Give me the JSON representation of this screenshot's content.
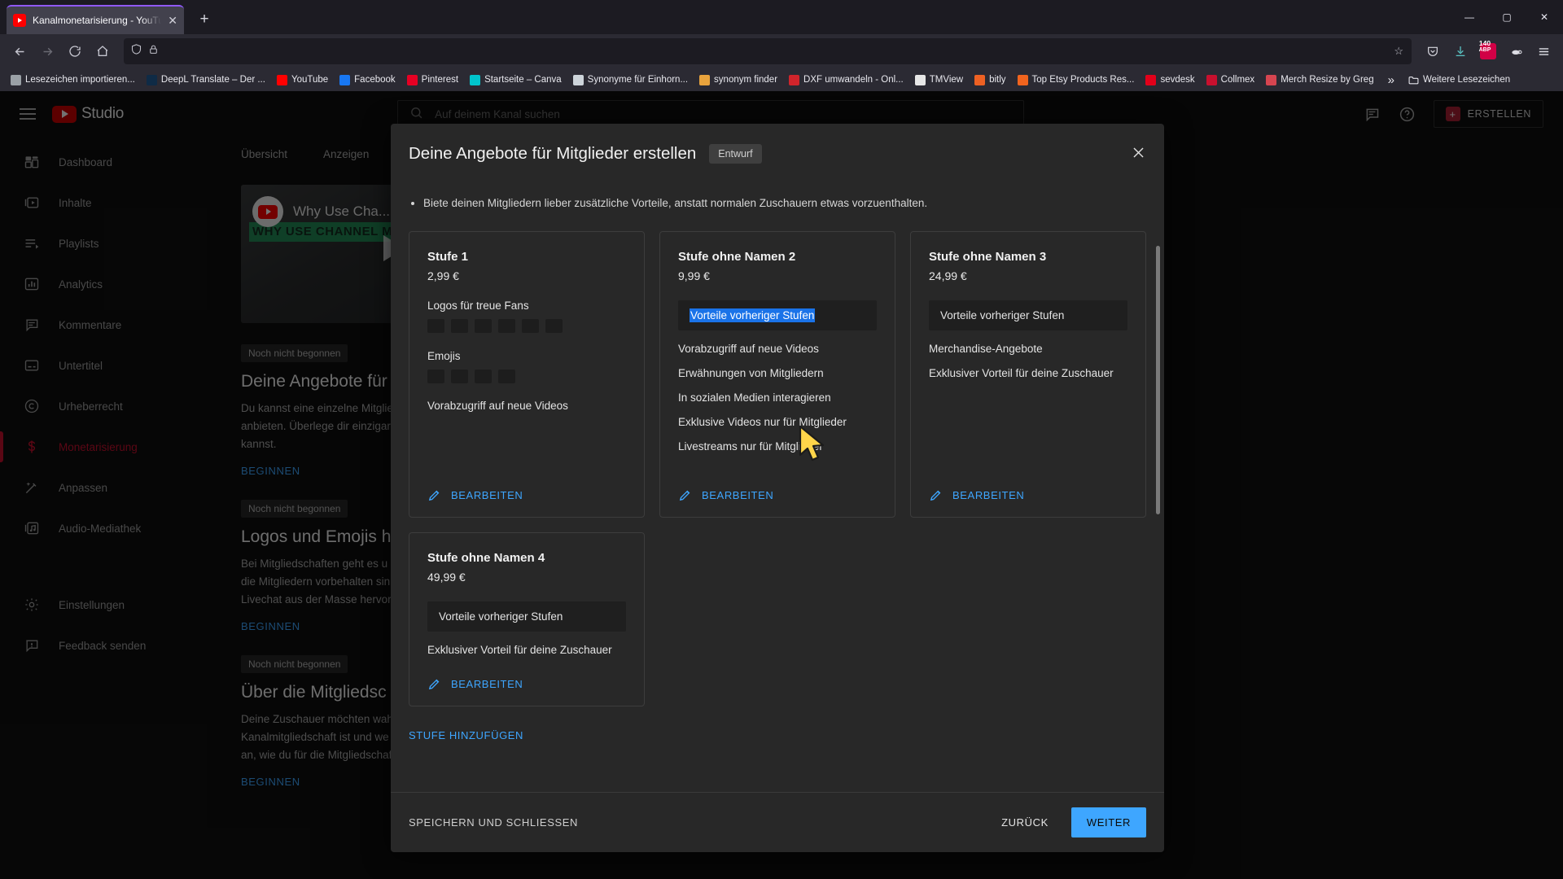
{
  "browser": {
    "tab": {
      "title": "Kanalmonetarisierung - YouTub",
      "close": "✕"
    },
    "newtab": "+",
    "window_controls": {
      "minimize": "—",
      "maximize": "▢",
      "close": "✕"
    },
    "nav": {
      "back": "←",
      "forward": "→",
      "reload": "⟳",
      "home": "⌂",
      "shield": "shield-icon",
      "lock": "lock-icon",
      "star": "☆"
    },
    "toolbar_right": {
      "pocket": "pocket-icon",
      "downloads": "downloads-icon",
      "adblock_count": "140",
      "adblock_label": "ABP",
      "container": "container-icon",
      "menu": "≡"
    },
    "bookmarks": [
      {
        "label": "Lesezeichen importieren...",
        "icon": "import-icon",
        "color": "#9aa0a6"
      },
      {
        "label": "DeepL Translate – Der ...",
        "icon": "deepl-icon",
        "color": "#0f2b46"
      },
      {
        "label": "YouTube",
        "icon": "youtube-icon",
        "color": "#ff0000"
      },
      {
        "label": "Facebook",
        "icon": "facebook-icon",
        "color": "#1877f2"
      },
      {
        "label": "Pinterest",
        "icon": "pinterest-icon",
        "color": "#e60023"
      },
      {
        "label": "Startseite – Canva",
        "icon": "canva-icon",
        "color": "#00c4cc"
      },
      {
        "label": "Synonyme für Einhorn...",
        "icon": "synonym-icon",
        "color": "#cdd4da"
      },
      {
        "label": "synonym finder",
        "icon": "synonym-finder-icon",
        "color": "#e8a33d"
      },
      {
        "label": "DXF umwandeln - Onl...",
        "icon": "dxf-icon",
        "color": "#d0242b"
      },
      {
        "label": "TMView",
        "icon": "tmview-icon",
        "color": "#e6e6e6"
      },
      {
        "label": "bitly",
        "icon": "bitly-icon",
        "color": "#ee6123"
      },
      {
        "label": "Top Etsy Products Res...",
        "icon": "etsy-icon",
        "color": "#f1641e"
      },
      {
        "label": "sevdesk",
        "icon": "sevdesk-icon",
        "color": "#e2001a"
      },
      {
        "label": "Collmex",
        "icon": "collmex-icon",
        "color": "#c8102e"
      },
      {
        "label": "Merch Resize by Greg",
        "icon": "merch-icon",
        "color": "#d64550"
      }
    ],
    "bookmarks_overflow": "»",
    "other_bookmarks": {
      "label": "Weitere Lesezeichen",
      "icon": "folder-icon"
    }
  },
  "studio": {
    "logo_word": "Studio",
    "search_placeholder": "Auf deinem Kanal suchen",
    "search_icon": "search-icon",
    "menu_icon": "hamburger-icon",
    "header_icons": {
      "comments": "comment-icon",
      "help": "help-icon"
    },
    "create_button": {
      "label": "ERSTELLEN",
      "icon": "plus-icon"
    },
    "sidebar": [
      {
        "label": "Dashboard",
        "icon": "dashboard-icon",
        "active": false
      },
      {
        "label": "Inhalte",
        "icon": "content-video-icon",
        "active": false
      },
      {
        "label": "Playlists",
        "icon": "playlist-icon",
        "active": false
      },
      {
        "label": "Analytics",
        "icon": "analytics-bar-icon",
        "active": false
      },
      {
        "label": "Kommentare",
        "icon": "comment-icon",
        "active": false
      },
      {
        "label": "Untertitel",
        "icon": "subtitles-icon",
        "active": false
      },
      {
        "label": "Urheberrecht",
        "icon": "copyright-icon",
        "active": false
      },
      {
        "label": "Monetarisierung",
        "icon": "dollar-icon",
        "active": true
      },
      {
        "label": "Anpassen",
        "icon": "magic-wand-icon",
        "active": false
      },
      {
        "label": "Audio-Mediathek",
        "icon": "audio-library-icon",
        "active": false
      }
    ],
    "sidebar_bottom": [
      {
        "label": "Einstellungen",
        "icon": "gear-icon"
      },
      {
        "label": "Feedback senden",
        "icon": "feedback-icon"
      }
    ],
    "tabs": [
      {
        "label": "Übersicht"
      },
      {
        "label": "Anzeigen"
      }
    ],
    "video_card": {
      "title": "Why Use Cha...",
      "thumb_text": "WHY USE CHANNEL MEMBERSHIPS"
    },
    "tasks": [
      {
        "badge": "Noch nicht begonnen",
        "title": "Deine Angebote für",
        "desc": "Du kannst eine einzelne Mitglie\nanbieten. Überlege dir einzigar\nkannst.",
        "link": "BEGINNEN"
      },
      {
        "badge": "Noch nicht begonnen",
        "title": "Logos und Emojis h",
        "desc": "Bei Mitgliedschaften geht es u\ndie Mitgliedern vorbehalten sin\nLivechat aus der Masse hervor",
        "link": "BEGINNEN"
      },
      {
        "badge": "Noch nicht begonnen",
        "title": "Über die Mitgliedsc",
        "desc": "Deine Zuschauer möchten wah\nKanalmitgliedschaft ist und we\nan, wie du für die Mitgliedschaft auf deinem Kanal werben kannst.",
        "link": "BEGINNEN"
      }
    ]
  },
  "modal": {
    "title": "Deine Angebote für Mitglieder erstellen",
    "badge": "Entwurf",
    "close_icon": "close-icon",
    "intro_bullet": "Biete deinen Mitgliedern lieber zusätzliche Vorteile, anstatt normalen Zuschauern etwas vorzuenthalten.",
    "tiers": [
      {
        "name": "Stufe 1",
        "price": "2,99 €",
        "logos_label": "Logos für treue Fans",
        "logos_count": 6,
        "emojis_label": "Emojis",
        "emojis_count": 4,
        "perks": [
          "Vorabzugriff auf neue Videos"
        ],
        "edit_label": "BEARBEITEN",
        "edit_icon": "pencil-icon"
      },
      {
        "name": "Stufe ohne Namen 2",
        "price": "9,99 €",
        "chip": "Vorteile vorheriger Stufen",
        "chip_selected": true,
        "perks": [
          "Vorabzugriff auf neue Videos",
          "Erwähnungen von Mitgliedern",
          "In sozialen Medien interagieren",
          "Exklusive Videos nur für Mitglieder",
          "Livestreams nur für Mitglieder"
        ],
        "edit_label": "BEARBEITEN",
        "edit_icon": "pencil-icon"
      },
      {
        "name": "Stufe ohne Namen 3",
        "price": "24,99 €",
        "chip": "Vorteile vorheriger Stufen",
        "chip_selected": false,
        "perks": [
          "Merchandise-Angebote",
          "Exklusiver Vorteil für deine Zuschauer"
        ],
        "edit_label": "BEARBEITEN",
        "edit_icon": "pencil-icon"
      },
      {
        "name": "Stufe ohne Namen 4",
        "price": "49,99 €",
        "chip": "Vorteile vorheriger Stufen",
        "chip_selected": false,
        "perks": [
          "Exklusiver Vorteil für deine Zuschauer"
        ],
        "edit_label": "BEARBEITEN",
        "edit_icon": "pencil-icon"
      }
    ],
    "add_tier_label": "STUFE HINZUFÜGEN",
    "footer": {
      "save_close": "SPEICHERN UND SCHLIESSEN",
      "back": "ZURÜCK",
      "next": "WEITER"
    }
  },
  "colors": {
    "accent_blue": "#3ea6ff",
    "selection_blue": "#1a73e8",
    "youtube_red": "#c8102e",
    "cursor_yellow": "#ffd54a"
  }
}
